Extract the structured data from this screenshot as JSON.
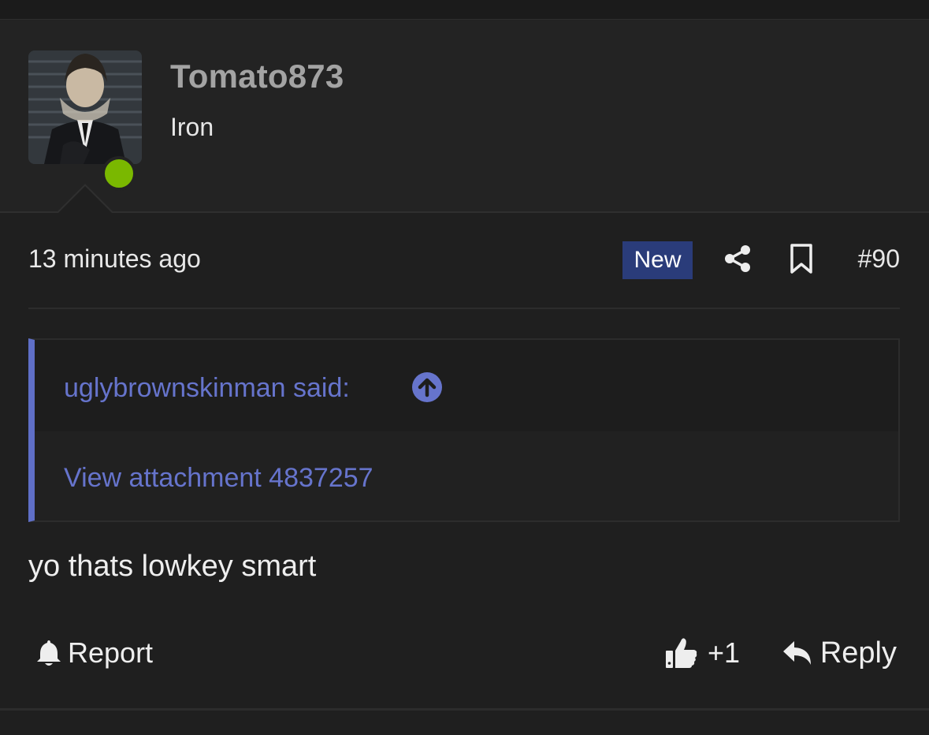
{
  "post": {
    "author": "Tomato873",
    "rank": "Iron",
    "timestamp": "13 minutes ago",
    "new_badge": "New",
    "post_number": "#90",
    "quote": {
      "author_line": "uglybrownskinman said:",
      "body": "View attachment 4837257"
    },
    "text": "yo thats lowkey smart",
    "actions": {
      "report": "Report",
      "like_count": "+1",
      "reply": "Reply"
    }
  },
  "colors": {
    "online": "#7ab800",
    "new_badge": "#2a3c7a",
    "quote_accent": "#5f6fc7",
    "link": "#6674cc"
  },
  "icons": [
    "share-icon",
    "bookmark-icon",
    "arrow-up-circle-icon",
    "bell-icon",
    "thumbs-up-icon",
    "reply-icon"
  ]
}
